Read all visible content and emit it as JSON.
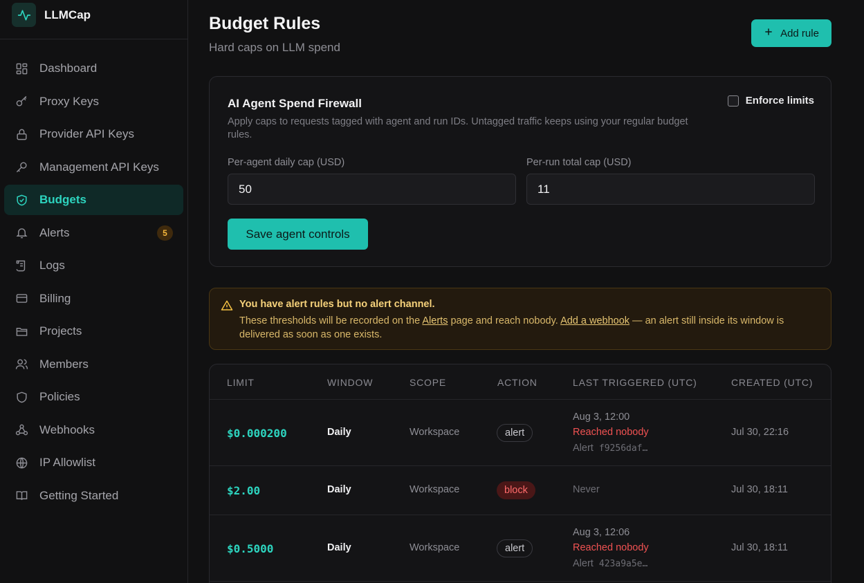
{
  "brand": {
    "name": "LLMCap"
  },
  "sidebar": {
    "items": [
      {
        "label": "Dashboard",
        "icon": "dashboard-icon"
      },
      {
        "label": "Proxy Keys",
        "icon": "key-icon"
      },
      {
        "label": "Provider API Keys",
        "icon": "lock-icon"
      },
      {
        "label": "Management API Keys",
        "icon": "wrench-key-icon"
      },
      {
        "label": "Budgets",
        "icon": "shield-check-icon",
        "active": true
      },
      {
        "label": "Alerts",
        "icon": "bell-icon",
        "badge": "5"
      },
      {
        "label": "Logs",
        "icon": "scroll-icon"
      },
      {
        "label": "Billing",
        "icon": "credit-card-icon"
      },
      {
        "label": "Projects",
        "icon": "folder-icon"
      },
      {
        "label": "Members",
        "icon": "users-icon"
      },
      {
        "label": "Policies",
        "icon": "shield-icon"
      },
      {
        "label": "Webhooks",
        "icon": "webhook-icon"
      },
      {
        "label": "IP Allowlist",
        "icon": "globe-icon"
      },
      {
        "label": "Getting Started",
        "icon": "book-icon"
      }
    ]
  },
  "header": {
    "title": "Budget Rules",
    "subtitle": "Hard caps on LLM spend",
    "add_rule_label": "Add rule"
  },
  "firewall": {
    "title": "AI Agent Spend Firewall",
    "description": "Apply caps to requests tagged with agent and run IDs. Untagged traffic keeps using your regular budget rules.",
    "enforce_label": "Enforce limits",
    "enforce_checked": false,
    "daily_cap_label": "Per-agent daily cap (USD)",
    "daily_cap_value": "50",
    "run_cap_label": "Per-run total cap (USD)",
    "run_cap_value": "11",
    "save_label": "Save agent controls"
  },
  "warning": {
    "title": "You have alert rules but no alert channel.",
    "body_prefix": "These thresholds will be recorded on the ",
    "alerts_link": "Alerts",
    "body_middle": " page and reach nobody. ",
    "webhook_link": "Add a webhook",
    "body_suffix": " — an alert still inside its window is delivered as soon as one exists."
  },
  "table": {
    "columns": [
      "LIMIT",
      "WINDOW",
      "SCOPE",
      "ACTION",
      "LAST TRIGGERED (UTC)",
      "CREATED (UTC)"
    ],
    "rows": [
      {
        "limit": "$0.000200",
        "window": "Daily",
        "scope": "Workspace",
        "action": "alert",
        "last_time": "Aug 3, 12:00",
        "last_status": "Reached nobody",
        "last_alert_prefix": "Alert",
        "last_alert_id": "f9256daf…",
        "created": "Jul 30, 22:16"
      },
      {
        "limit": "$2.00",
        "window": "Daily",
        "scope": "Workspace",
        "action": "block",
        "last_never": "Never",
        "created": "Jul 30, 18:11"
      },
      {
        "limit": "$0.5000",
        "window": "Daily",
        "scope": "Workspace",
        "action": "alert",
        "last_time": "Aug 3, 12:06",
        "last_status": "Reached nobody",
        "last_alert_prefix": "Alert",
        "last_alert_id": "423a9a5e…",
        "created": "Jul 30, 18:11"
      }
    ]
  },
  "colors": {
    "accent": "#1fbfae",
    "danger": "#f05252",
    "warning": "#f6d27b"
  }
}
